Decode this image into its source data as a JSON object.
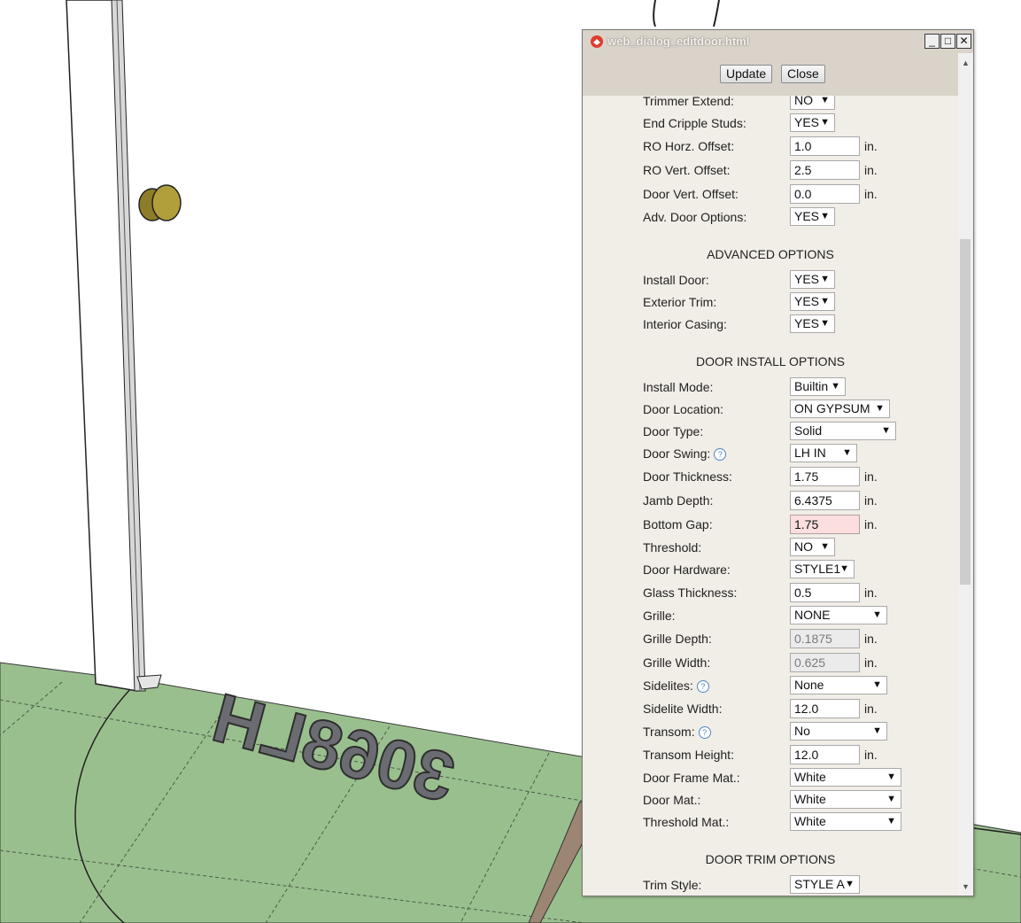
{
  "window": {
    "title": "web_dialog_editdoor.html"
  },
  "buttons": {
    "update": "Update",
    "close": "Close"
  },
  "floor_label": "3068LH",
  "rows_top": [
    {
      "label": "Trimmer Extend:",
      "type": "select",
      "value": "NO"
    },
    {
      "label": "End Cripple Studs:",
      "type": "select",
      "value": "YES"
    },
    {
      "label": "RO Horz. Offset:",
      "type": "input",
      "value": "1.0",
      "unit": "in."
    },
    {
      "label": "RO Vert. Offset:",
      "type": "input",
      "value": "2.5",
      "unit": "in."
    },
    {
      "label": "Door Vert. Offset:",
      "type": "input",
      "value": "0.0",
      "unit": "in."
    },
    {
      "label": "Adv. Door Options:",
      "type": "select",
      "value": "YES"
    }
  ],
  "advanced": {
    "heading": "ADVANCED OPTIONS",
    "rows": [
      {
        "label": "Install Door:",
        "type": "select",
        "value": "YES"
      },
      {
        "label": "Exterior Trim:",
        "type": "select",
        "value": "YES"
      },
      {
        "label": "Interior Casing:",
        "type": "select",
        "value": "YES"
      }
    ]
  },
  "install": {
    "heading": "DOOR INSTALL OPTIONS",
    "rows": [
      {
        "label": "Install Mode:",
        "type": "select",
        "value": "Builtin"
      },
      {
        "label": "Door Location:",
        "type": "select",
        "value": "ON GYPSUM"
      },
      {
        "label": "Door Type:",
        "type": "select",
        "value": "Solid"
      },
      {
        "label": "Door Swing:",
        "type": "select",
        "value": "LH IN",
        "help": true
      },
      {
        "label": "Door Thickness:",
        "type": "input",
        "value": "1.75",
        "unit": "in."
      },
      {
        "label": "Jamb Depth:",
        "type": "input",
        "value": "6.4375",
        "unit": "in."
      },
      {
        "label": "Bottom Gap:",
        "type": "input",
        "value": "1.75",
        "unit": "in.",
        "state": "error"
      },
      {
        "label": "Threshold:",
        "type": "select",
        "value": "NO"
      },
      {
        "label": "Door Hardware:",
        "type": "select",
        "value": "STYLE1"
      },
      {
        "label": "Glass Thickness:",
        "type": "input",
        "value": "0.5",
        "unit": "in."
      },
      {
        "label": "Grille:",
        "type": "select",
        "value": "NONE"
      },
      {
        "label": "Grille Depth:",
        "type": "input",
        "value": "0.1875",
        "unit": "in.",
        "state": "disabled"
      },
      {
        "label": "Grille Width:",
        "type": "input",
        "value": "0.625",
        "unit": "in.",
        "state": "disabled"
      },
      {
        "label": "Sidelites:",
        "type": "select",
        "value": "None",
        "help": true
      },
      {
        "label": "Sidelite Width:",
        "type": "input",
        "value": "12.0",
        "unit": "in."
      },
      {
        "label": "Transom:",
        "type": "select",
        "value": "No",
        "help": true
      },
      {
        "label": "Transom Height:",
        "type": "input",
        "value": "12.0",
        "unit": "in."
      },
      {
        "label": "Door Frame Mat.:",
        "type": "select",
        "value": "White"
      },
      {
        "label": "Door Mat.:",
        "type": "select",
        "value": "White"
      },
      {
        "label": "Threshold Mat.:",
        "type": "select",
        "value": "White"
      }
    ]
  },
  "trim": {
    "heading": "DOOR TRIM OPTIONS",
    "rows": [
      {
        "label": "Trim Style:",
        "type": "select",
        "value": "STYLE A"
      }
    ]
  },
  "colors": {
    "floor": "#9abf8e",
    "dialog_bg": "#f1ede7",
    "title_bg": "#d9d3ca",
    "error_field": "#fcdede",
    "door_knob": "#9b8a2c"
  }
}
